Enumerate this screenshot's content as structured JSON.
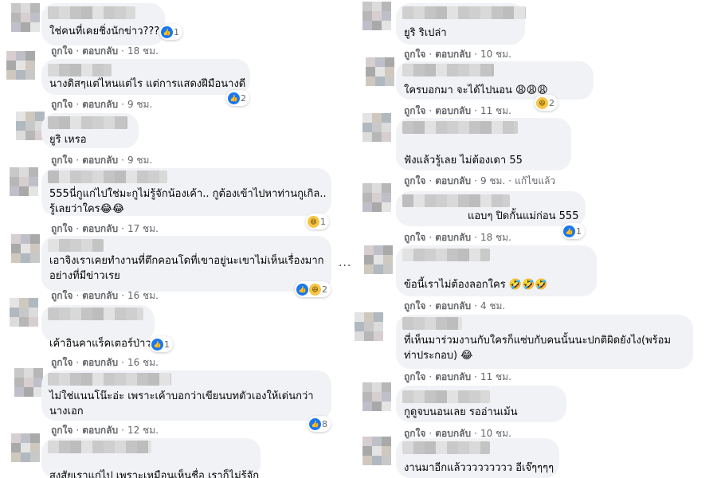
{
  "ellipsis": "...",
  "actions": {
    "like": "ถูกใจ",
    "reply": "ตอบกลับ",
    "dot": "·"
  },
  "left": [
    {
      "text": [
        "ใช่คนที่เคยชิ่งนักข่าว???"
      ],
      "time": "18 ชม.",
      "reactions": {
        "icons": [
          "like-icon"
        ],
        "count": "1"
      }
    },
    {
      "text": [
        "นางดิสๆแต่ไหนแต่ไร แต่การแสดงฝีมือนางดี"
      ],
      "time": "9 ชม.",
      "reactions": {
        "icons": [
          "like-icon"
        ],
        "count": "2"
      }
    },
    {
      "text": [
        "ยูริ เหรอ"
      ],
      "time": "9 ชม.",
      "reactions": null
    },
    {
      "text": [
        "555นี่กูแก่ไปใช่มะกูไม่รู้จักน้องเค้า.. กูต้องเข้าไปหาท่านกูเกิล..",
        "รู้เลยว่าใคร😂😂"
      ],
      "time": "17 ชม.",
      "reactions": {
        "icons": [
          "haha-icon"
        ],
        "count": "1"
      }
    },
    {
      "text": [
        "เอาจิงเราเคยทำงานที่ตึกคอนโดที่เขาอยู่นะเขาไม่เห็นเรื่องมาก",
        "อย่างที่มีข่าวเรย"
      ],
      "time": "16 ชม.",
      "reactions": {
        "icons": [
          "like-icon",
          "haha-icon"
        ],
        "count": "2"
      }
    },
    {
      "text": [
        "เค้าอินคาแร็คเตอร์ป่าว"
      ],
      "time": "16 ชม.",
      "reactions": {
        "icons": [
          "like-icon"
        ],
        "count": "1"
      }
    },
    {
      "text": [
        "ไม่ใช่แนนโน๊ะอ่ะ เพราะเค้าบอกว่าเขียนบทตัวเองให้เด่นกว่า",
        "นางเอก"
      ],
      "time": "12 ชม.",
      "reactions": {
        "icons": [
          "like-icon"
        ],
        "count": "8"
      }
    },
    {
      "text": [
        "สงสัยเราแก่ไป เพราะเหมือนเห็นชื่อ เราก็ไม่รู้จัก"
      ],
      "time": "",
      "reactions": null
    }
  ],
  "right": [
    {
      "text": [
        "ยูริ ริเปล่า"
      ],
      "time": "10 ชม.",
      "edited": "",
      "reactions": null
    },
    {
      "text": [
        "ใครบอกมา จะได้ไปนอน 😩😩😩"
      ],
      "time": "11 ชม.",
      "edited": "",
      "reactions": {
        "icons": [
          "haha-icon"
        ],
        "count": "2"
      }
    },
    {
      "text": [
        "ฟังแล้วรู้เลย ไม่ต้องเดา 55"
      ],
      "time": "9 ชม.",
      "edited": "แก้ไขแล้ว",
      "reactions": null
    },
    {
      "text": [
        "แอบๆ ปิดกั้นแม่ก่อน 555"
      ],
      "time": "18 ชม.",
      "edited": "",
      "reactions": {
        "icons": [
          "like-icon"
        ],
        "count": "1"
      }
    },
    {
      "text": [
        "ข้อนี้เราไม่ต้องลอกใคร 🤣🤣🤣"
      ],
      "time": "4 ชม.",
      "edited": "",
      "reactions": null
    },
    {
      "text": [
        "ที่เห็นมาร่วมงานกับใครก็แซ่บกับคนนั้นนะปกติผิดยังไง(พร้อม",
        "ท่าประกอบ) 😂"
      ],
      "time": "11 ชม.",
      "edited": "",
      "reactions": null
    },
    {
      "text": [
        "กูดูจบนอนเลย รออ่านเม้น"
      ],
      "time": "10 ชม.",
      "edited": "",
      "reactions": null
    },
    {
      "text": [
        "งานมาอีกแล้ววววววววว อีเจ๊ๆๆๆๆ"
      ],
      "time": "",
      "edited": "",
      "reactions": null
    }
  ]
}
